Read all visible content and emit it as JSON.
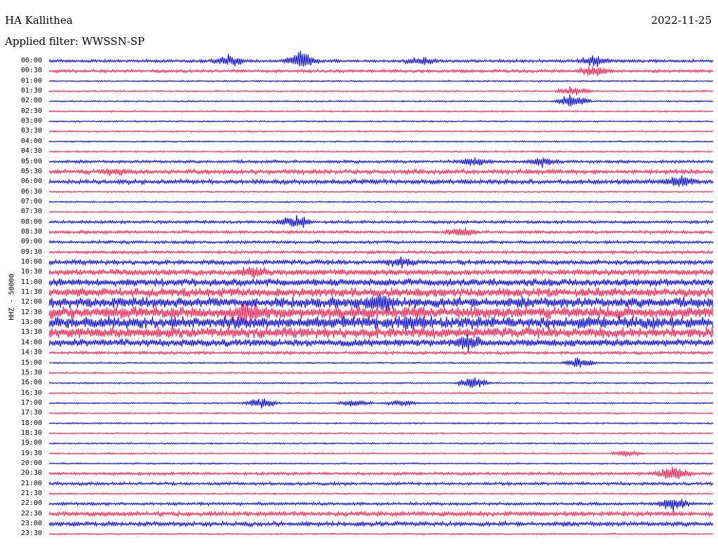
{
  "header": {
    "station": "HA Kallithea",
    "date": "2022-11-25",
    "filter": "Applied filter: WWSSN-SP"
  },
  "chart_data": {
    "type": "line",
    "title": "HA Kallithea",
    "ylabel": "HHZ - 50000",
    "row_colors": [
      "#0000e6",
      "#ff1a4d"
    ],
    "rows": [
      "00:00",
      "00:30",
      "01:00",
      "01:30",
      "02:00",
      "02:30",
      "03:00",
      "03:30",
      "04:00",
      "04:30",
      "05:00",
      "05:30",
      "06:00",
      "06:30",
      "07:00",
      "07:30",
      "08:00",
      "08:30",
      "09:00",
      "09:30",
      "10:00",
      "10:30",
      "11:00",
      "11:30",
      "12:00",
      "12:30",
      "13:00",
      "13:30",
      "14:00",
      "14:30",
      "15:00",
      "15:30",
      "16:00",
      "16:30",
      "17:00",
      "17:30",
      "18:00",
      "18:30",
      "19:00",
      "19:30",
      "20:00",
      "20:30",
      "21:00",
      "21:30",
      "22:00",
      "22:30",
      "23:00",
      "23:30"
    ],
    "noise_level": [
      2,
      2,
      1,
      1,
      1,
      1,
      1,
      1,
      1,
      1,
      2,
      3,
      3,
      1,
      1,
      1,
      2,
      2,
      2,
      2,
      3,
      4,
      5,
      6,
      7,
      8,
      8,
      7,
      5,
      2,
      1,
      1,
      1,
      1,
      1,
      1,
      1,
      1,
      1,
      1,
      1,
      2,
      2,
      1,
      2,
      3,
      3,
      1
    ],
    "events": [
      {
        "row": "00:00",
        "t": 0.27,
        "amp": 10
      },
      {
        "row": "00:00",
        "t": 0.38,
        "amp": 14
      },
      {
        "row": "00:00",
        "t": 0.56,
        "amp": 6
      },
      {
        "row": "00:00",
        "t": 0.82,
        "amp": 9
      },
      {
        "row": "00:30",
        "t": 0.82,
        "amp": 8
      },
      {
        "row": "01:30",
        "t": 0.79,
        "amp": 10
      },
      {
        "row": "02:00",
        "t": 0.79,
        "amp": 14
      },
      {
        "row": "05:00",
        "t": 0.64,
        "amp": 7
      },
      {
        "row": "05:00",
        "t": 0.74,
        "amp": 7
      },
      {
        "row": "05:30",
        "t": 0.1,
        "amp": 5
      },
      {
        "row": "06:00",
        "t": 0.95,
        "amp": 9
      },
      {
        "row": "08:00",
        "t": 0.37,
        "amp": 11
      },
      {
        "row": "08:30",
        "t": 0.62,
        "amp": 7
      },
      {
        "row": "10:00",
        "t": 0.53,
        "amp": 8
      },
      {
        "row": "10:30",
        "t": 0.31,
        "amp": 8
      },
      {
        "row": "12:00",
        "t": 0.5,
        "amp": 12
      },
      {
        "row": "12:30",
        "t": 0.3,
        "amp": 12
      },
      {
        "row": "13:00",
        "t": 0.55,
        "amp": 10
      },
      {
        "row": "14:00",
        "t": 0.63,
        "amp": 9
      },
      {
        "row": "15:00",
        "t": 0.8,
        "amp": 9
      },
      {
        "row": "16:00",
        "t": 0.64,
        "amp": 11
      },
      {
        "row": "17:00",
        "t": 0.32,
        "amp": 11
      },
      {
        "row": "17:00",
        "t": 0.46,
        "amp": 6
      },
      {
        "row": "17:00",
        "t": 0.53,
        "amp": 5
      },
      {
        "row": "19:30",
        "t": 0.87,
        "amp": 5
      },
      {
        "row": "20:30",
        "t": 0.94,
        "amp": 14
      },
      {
        "row": "22:00",
        "t": 0.94,
        "amp": 10
      }
    ]
  }
}
